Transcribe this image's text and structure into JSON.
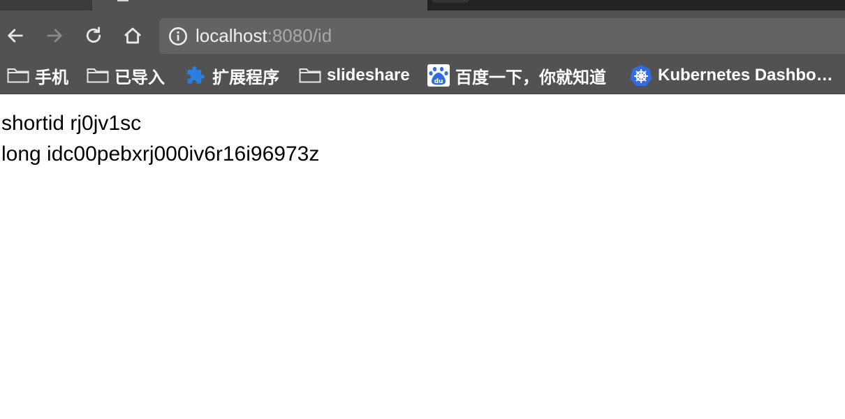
{
  "browser": {
    "address_bar": {
      "host": "localhost",
      "rest": ":8080/id"
    },
    "icons": {
      "back": "back-arrow-icon",
      "forward": "forward-arrow-icon",
      "reload": "reload-icon",
      "home": "home-icon",
      "site_info": "info-icon"
    },
    "bookmarks": [
      {
        "label": "手机",
        "icon": "folder-icon"
      },
      {
        "label": "已导入",
        "icon": "folder-icon"
      },
      {
        "label": "扩展程序",
        "icon": "puzzle-piece-icon"
      },
      {
        "label": "slideshare",
        "icon": "folder-icon"
      },
      {
        "label": "百度一下，你就知道",
        "icon": "baidu-paw-icon"
      },
      {
        "label": "Kubernetes Dashbo…",
        "icon": "kubernetes-helm-icon"
      }
    ],
    "colors": {
      "chrome_dark": "#525252",
      "tab_strip": "#222222",
      "omnibox_bg": "#636363",
      "puzzle_blue": "#2a7de1",
      "baidu_blue": "#2f6ee0",
      "kubernetes_blue": "#326ce5"
    }
  },
  "page": {
    "lines": [
      "shortid rj0jv1sc",
      "long idc00pebxrj000iv6r16i96973z"
    ]
  }
}
